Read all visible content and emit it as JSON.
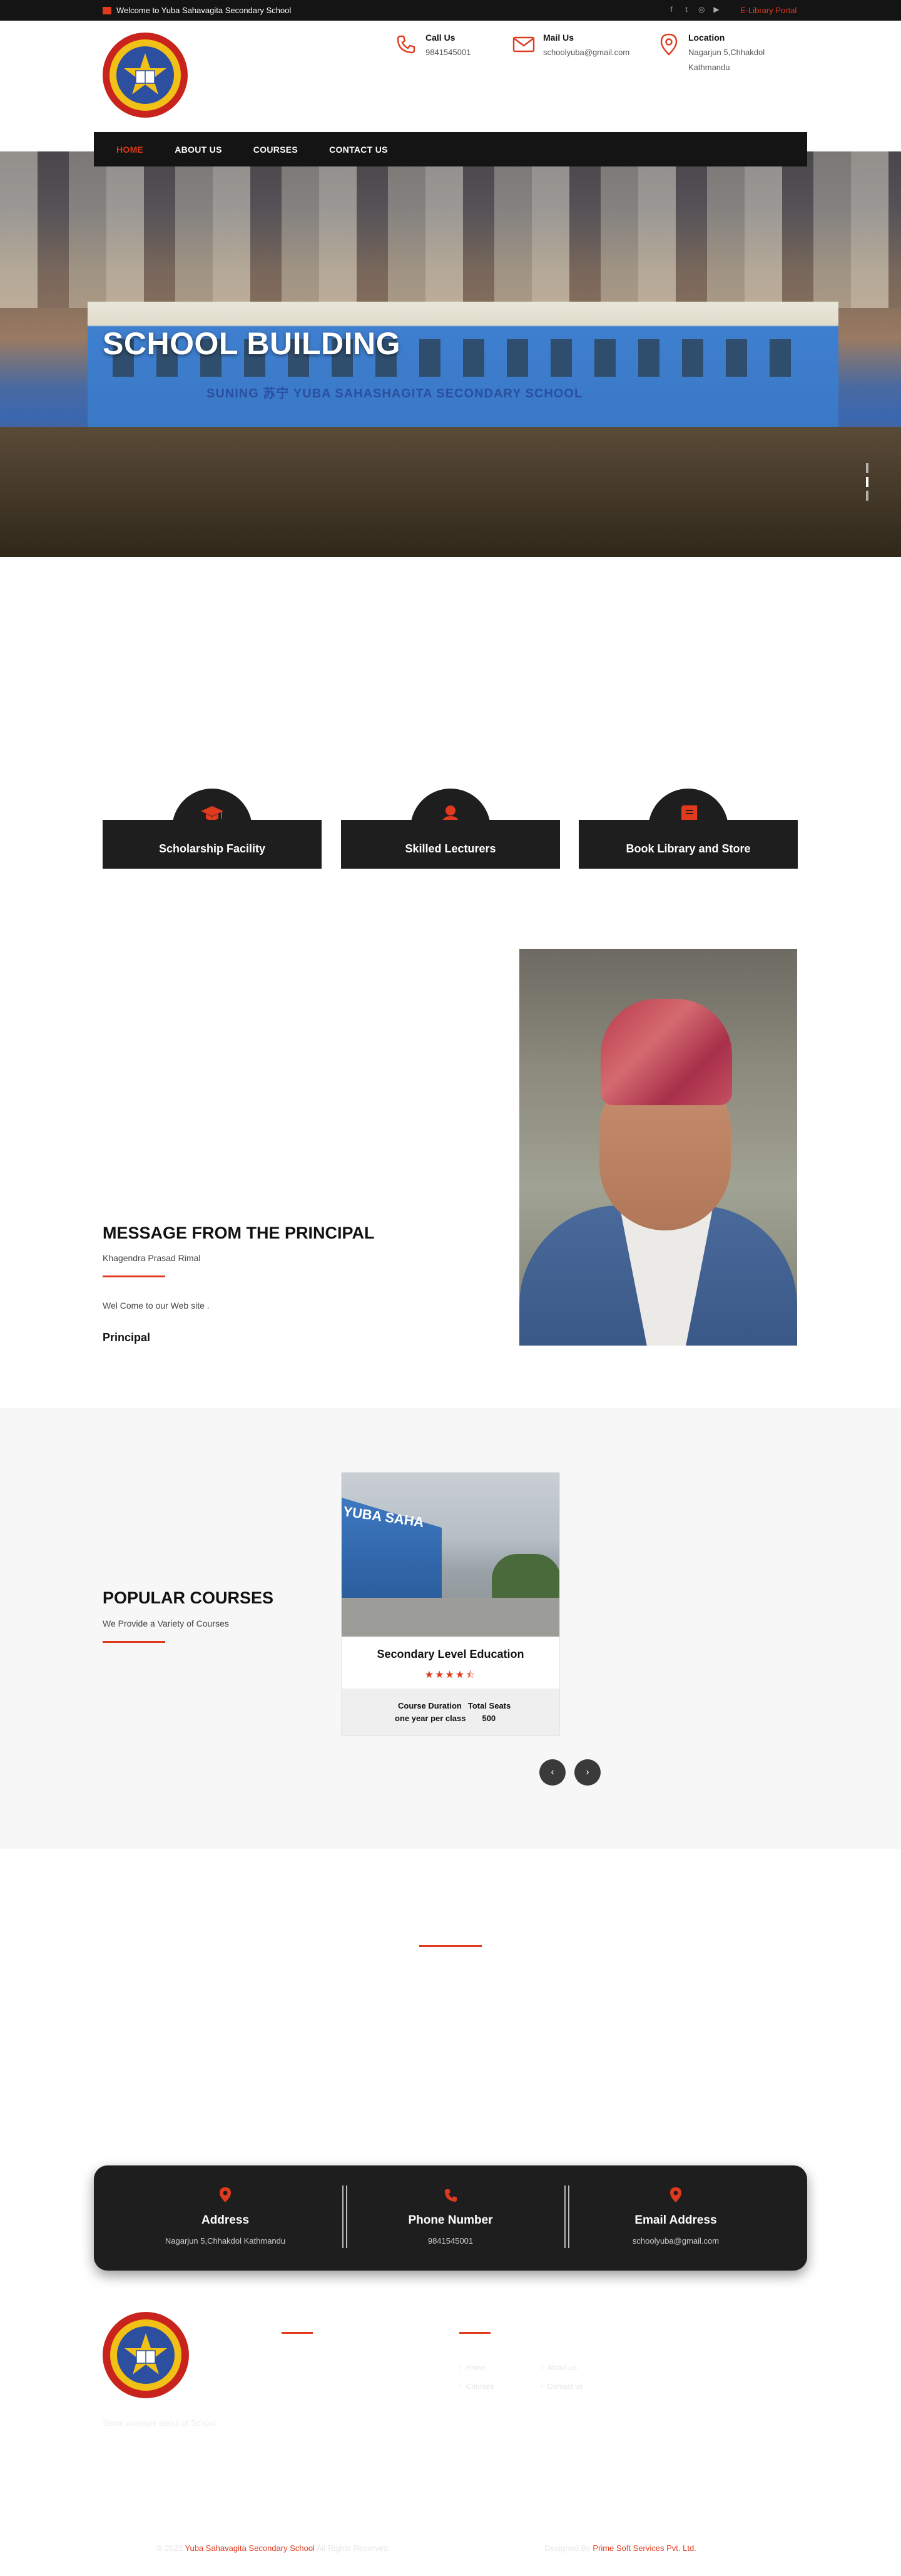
{
  "topbar": {
    "welcome": "Welcome to Yuba Sahavagita Secondary School",
    "social_icons": [
      "facebook-icon",
      "twitter-icon",
      "instagram-icon",
      "youtube-icon"
    ],
    "elibrary": "E-Library Portal"
  },
  "header": {
    "call_title": "Call Us",
    "call_value": "9841545001",
    "mail_title": "Mail Us",
    "mail_value": "schoolyuba@gmail.com",
    "location_title": "Location",
    "location_line1": "Nagarjun 5,Chhakdol",
    "location_line2": "Kathmandu"
  },
  "nav": {
    "items": [
      {
        "label": "HOME",
        "active": true
      },
      {
        "label": "ABOUT US",
        "active": false
      },
      {
        "label": "COURSES",
        "active": false
      },
      {
        "label": "CONTACT US",
        "active": false
      }
    ]
  },
  "hero": {
    "title": "SCHOOL BUILDING",
    "sign_text": "SUNING 苏宁 YUBA SAHASHAGITA SECONDARY SCHOOL"
  },
  "features": [
    {
      "label": "Scholarship Facility",
      "icon": "graduation-cap-icon"
    },
    {
      "label": "Skilled Lecturers",
      "icon": "user-icon"
    },
    {
      "label": "Book Library and Store",
      "icon": "book-icon"
    }
  ],
  "principal": {
    "heading": "MESSAGE FROM THE PRINCIPAL",
    "name": "Khagendra Prasad Rimal",
    "message": "Wel Come to our Web site .",
    "role": "Principal"
  },
  "courses": {
    "heading": "POPULAR COURSES",
    "subtitle": "We Provide a Variety of Courses",
    "card": {
      "title": "Secondary Level Education",
      "rating": 4.5,
      "duration_label": "Course Duration",
      "seats_label": "Total Seats",
      "duration_value": "one year per class",
      "seats_value": "500",
      "image_text": "YUBA SAHA"
    }
  },
  "contact": {
    "address_title": "Address",
    "address_value": "Nagarjun 5,Chhakdol Kathmandu",
    "phone_title": "Phone Number",
    "phone_value": "9841545001",
    "email_title": "Email Address",
    "email_value": "schoolyuba@gmail.com"
  },
  "footer": {
    "description": "Some example about of School",
    "links_col1": [
      "Home",
      "Courses"
    ],
    "links_col2": [
      "About us",
      "Contact us"
    ],
    "copyright_prefix": "© 2022",
    "school_name": "Yuba Sahavagita Secondary School",
    "rights": "All Rights Reserved",
    "designed_by": "Designed By",
    "company": "Prime Soft Services Pvt. Ltd."
  },
  "colors": {
    "accent": "#e03a1e",
    "dark": "#1e1e1e",
    "topbar": "#141414"
  }
}
